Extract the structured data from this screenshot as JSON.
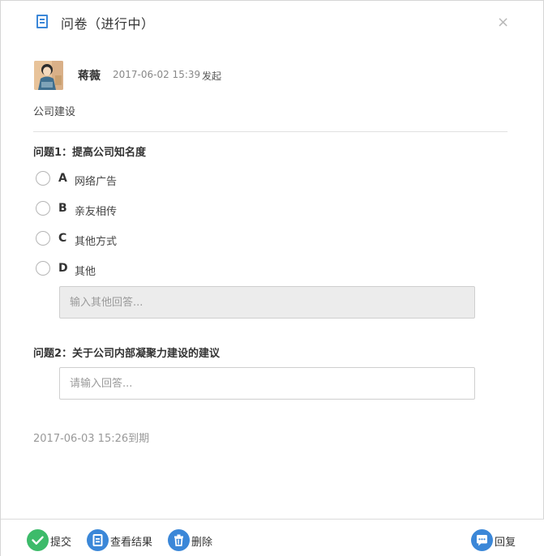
{
  "header": {
    "title": "问卷（进行中）",
    "close_glyph": "×"
  },
  "post": {
    "author": "蒋薇",
    "time": "2017-06-02 15:39",
    "action": "发起",
    "description": "公司建设"
  },
  "questions": [
    {
      "title": "问题1：提高公司知名度",
      "options": [
        {
          "letter": "A",
          "text": "网络广告"
        },
        {
          "letter": "B",
          "text": "亲友相传"
        },
        {
          "letter": "C",
          "text": "其他方式"
        },
        {
          "letter": "D",
          "text": "其他"
        }
      ],
      "other_placeholder": "输入其他回答..."
    },
    {
      "title": "问题2：关于公司内部凝聚力建设的建议",
      "answer_placeholder": "请输入回答..."
    }
  ],
  "deadline": "2017-06-03 15:26到期",
  "footer": {
    "submit": "提交",
    "view_results": "查看结果",
    "delete": "删除",
    "reply": "回复"
  },
  "colors": {
    "accent_blue": "#3b87d8",
    "submit_green": "#3dbb6a"
  },
  "icons": [
    "document-icon",
    "close-icon",
    "check-icon",
    "list-icon",
    "trash-icon",
    "chat-icon"
  ]
}
